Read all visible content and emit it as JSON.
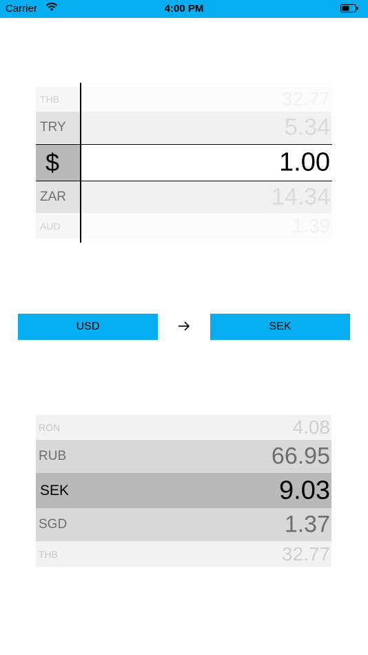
{
  "status": {
    "carrier": "Carrier",
    "time": "4:00 PM"
  },
  "source_picker": {
    "rows": [
      {
        "code": "THB",
        "value": "32.77"
      },
      {
        "code": "TRY",
        "value": "5.34"
      },
      {
        "code": "$",
        "value": "1.00"
      },
      {
        "code": "ZAR",
        "value": "14.34"
      },
      {
        "code": "AUD",
        "value": "1.39"
      }
    ]
  },
  "converter": {
    "from": "USD",
    "arrow": "→",
    "to": "SEK"
  },
  "target_picker": {
    "rows": [
      {
        "code": "RON",
        "value": "4.08"
      },
      {
        "code": "RUB",
        "value": "66.95"
      },
      {
        "code": "SEK",
        "value": "9.03"
      },
      {
        "code": "SGD",
        "value": "1.37"
      },
      {
        "code": "THB",
        "value": "32.77"
      }
    ]
  },
  "colors": {
    "accent": "#04aef0"
  }
}
